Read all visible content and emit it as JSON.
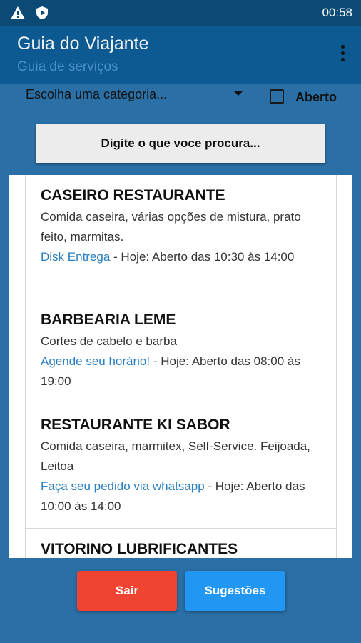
{
  "status_bar": {
    "icons": [
      "warning-icon",
      "play-shield-icon"
    ],
    "time": "00:58"
  },
  "app_bar": {
    "title": "Guia do Viajante",
    "subtitle": "Guia de serviços",
    "menu_icon": "overflow-menu-icon"
  },
  "filter": {
    "category_placeholder": "Escolha uma categoria...",
    "open_label": "Aberto",
    "open_checked": false
  },
  "search": {
    "label": "Digite o que voce procura..."
  },
  "listings": [
    {
      "name": "CASEIRO RESTAURANTE",
      "description": "Comida caseira, várias opções de mistura, prato feito, marmitas.",
      "action": "Disk Entrega",
      "hours": " - Hoje: Aberto das 10:30 às 14:00"
    },
    {
      "name": "BARBEARIA LEME",
      "description": "Cortes de cabelo e barba",
      "action": "Agende seu horário!",
      "hours": " - Hoje: Aberto das 08:00 às 19:00"
    },
    {
      "name": "RESTAURANTE KI SABOR",
      "description": "Comida caseira, marmitex, Self-Service. Feijoada, Leitoa",
      "action": "Faça seu pedido via whatsapp",
      "hours": " - Hoje: Aberto das 10:00 às 14:00"
    },
    {
      "name": "VITORINO LUBRIFICANTES",
      "description": "",
      "action": "",
      "hours": ""
    }
  ],
  "buttons": {
    "exit": "Sair",
    "suggestions": "Sugestões"
  },
  "colors": {
    "status_bar": "#0b4a75",
    "app_bar": "#0d5a92",
    "background": "#2a6fa5",
    "link": "#2b7fc0",
    "exit_button": "#f04433",
    "suggestions_button": "#2196f3"
  }
}
